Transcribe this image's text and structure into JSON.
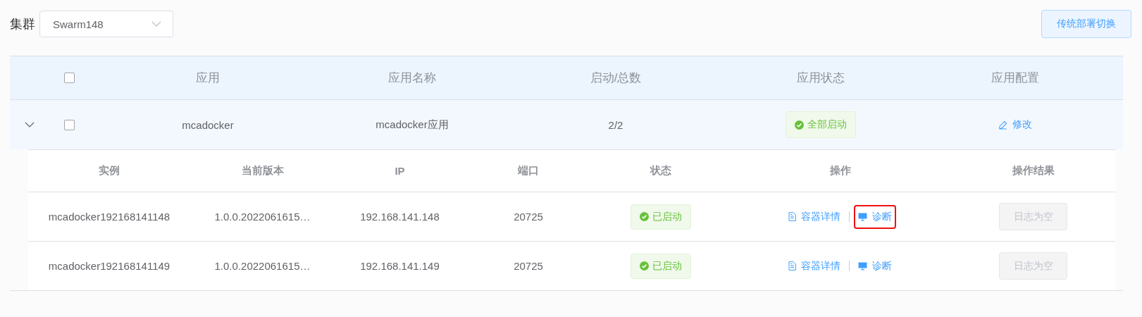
{
  "cluster": {
    "label": "集群",
    "value": "Swarm148"
  },
  "switch_button": "传统部署切换",
  "table": {
    "select_all_checked": false,
    "columns": [
      "应用",
      "应用名称",
      "启动/总数",
      "应用状态",
      "应用配置"
    ],
    "rows": [
      {
        "expanded": true,
        "checked": false,
        "app": "mcadocker",
        "name": "mcadocker应用",
        "count": "2/2",
        "status": "全部启动",
        "config_action": "修改",
        "instances": {
          "columns": [
            "实例",
            "当前版本",
            "IP",
            "端口",
            "状态",
            "操作",
            "操作结果"
          ],
          "rows": [
            {
              "instance": "mcadocker192168141148",
              "version": "1.0.0.2022061615…",
              "ip": "192.168.141.148",
              "port": "20725",
              "status": "已启动",
              "actions": [
                {
                  "kind": "details",
                  "label": "容器详情",
                  "highlighted": false
                },
                {
                  "kind": "diagnose",
                  "label": "诊断",
                  "highlighted": true
                }
              ],
              "result": "日志为空",
              "result_disabled": true
            },
            {
              "instance": "mcadocker192168141149",
              "version": "1.0.0.2022061615…",
              "ip": "192.168.141.149",
              "port": "20725",
              "status": "已启动",
              "actions": [
                {
                  "kind": "details",
                  "label": "容器详情",
                  "highlighted": false
                },
                {
                  "kind": "diagnose",
                  "label": "诊断",
                  "highlighted": false
                }
              ],
              "result": "日志为空",
              "result_disabled": true
            }
          ]
        }
      }
    ]
  }
}
